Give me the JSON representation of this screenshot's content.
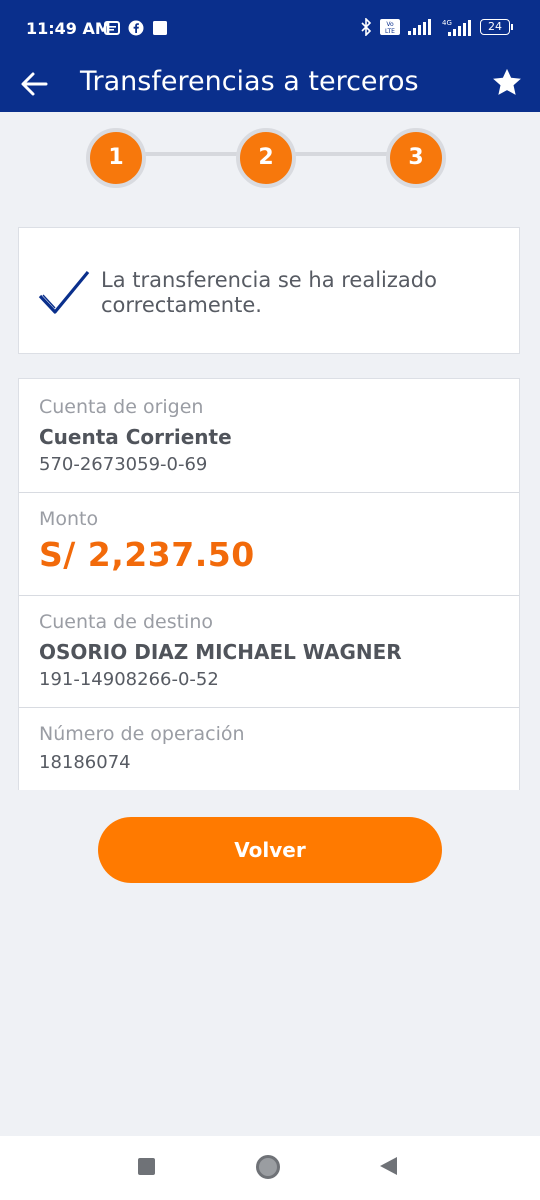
{
  "status_bar": {
    "time": "11:49 AM",
    "battery": "24",
    "network": "4G",
    "volte": "Vo LTE"
  },
  "app_bar": {
    "title": "Transferencias a terceros",
    "back_icon": "arrow-left-icon",
    "favorite_icon": "star-icon"
  },
  "stepper": {
    "steps": [
      "1",
      "2",
      "3"
    ],
    "color": "#f7780c"
  },
  "success": {
    "icon": "checkmark-icon",
    "message": "La transferencia se ha realizado correctamente."
  },
  "details": {
    "origin": {
      "label": "Cuenta de origen",
      "account_type": "Cuenta Corriente",
      "account_number": "570-2673059-0-69"
    },
    "amount": {
      "label": "Monto",
      "value": "S/ 2,237.50"
    },
    "destination": {
      "label": "Cuenta de destino",
      "name": "OSORIO DIAZ MICHAEL WAGNER",
      "account_number": "191-14908266-0-52"
    },
    "operation": {
      "label": "Número de operación",
      "value": "18186074"
    }
  },
  "actions": {
    "back_label": "Volver"
  },
  "colors": {
    "primary": "#0a2f8c",
    "accent": "#ff7a00",
    "amount": "#f26a0a"
  }
}
